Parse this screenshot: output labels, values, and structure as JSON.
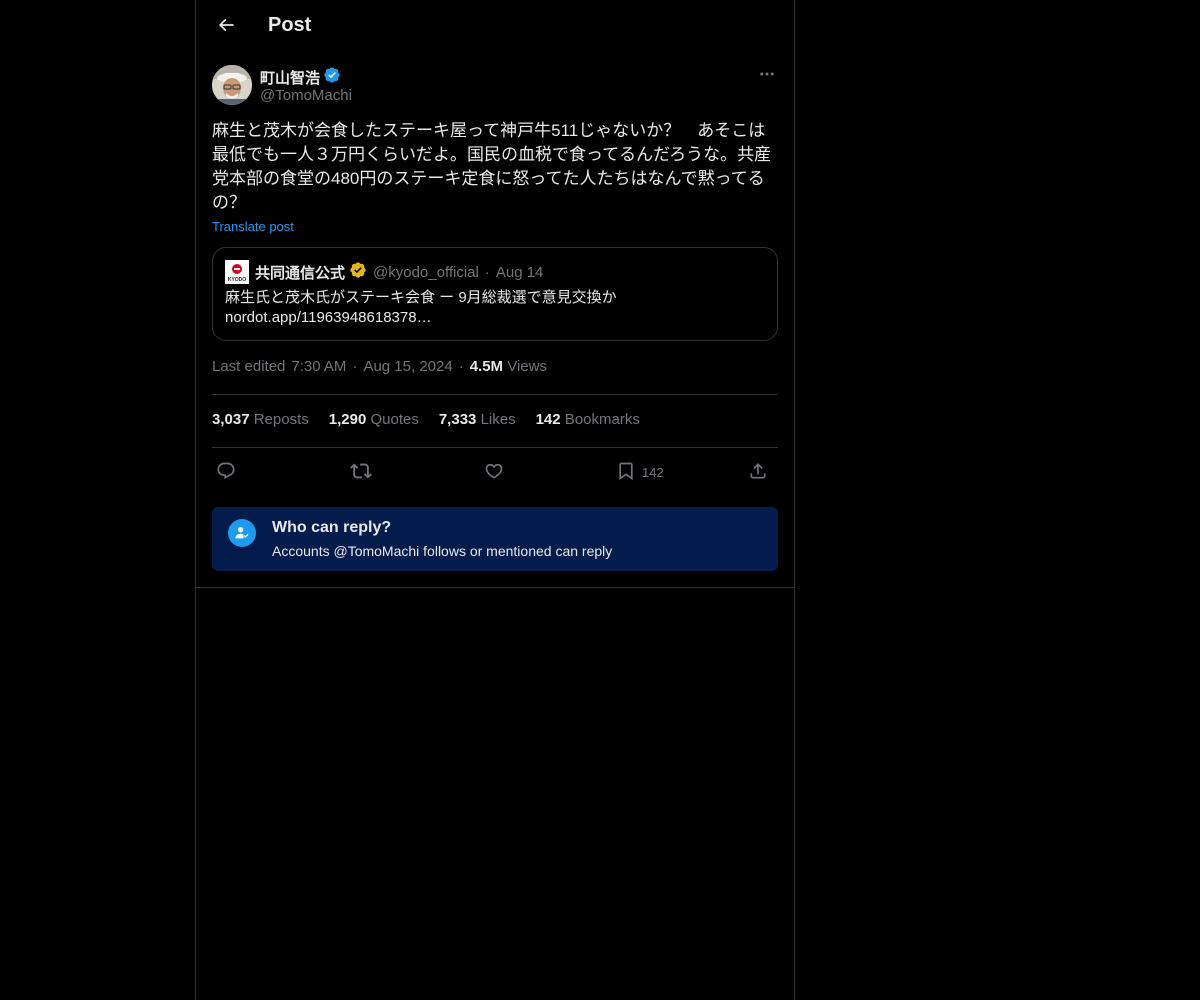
{
  "header": {
    "title": "Post"
  },
  "author": {
    "name": "町山智浩",
    "handle": "@TomoMachi"
  },
  "post": {
    "text": "麻生と茂木が会食したステーキ屋って神戸牛511じゃないか？　あそこは最低でも一人３万円くらいだよ。国民の血税で食ってるんだろうな。共産党本部の食堂の480円のステーキ定食に怒ってた人たちはなんで黙ってるの？",
    "translate_label": "Translate post"
  },
  "quote": {
    "name": "共同通信公式",
    "handle": "@kyodo_official",
    "separator": "·",
    "date": "Aug 14",
    "text": "麻生氏と茂木氏がステーキ会食 ー 9月総裁選で意見交換か",
    "link": "nordot.app/11963948618378…",
    "logo_text": "KYODO"
  },
  "meta": {
    "edited": "Last edited",
    "time": "7:30 AM",
    "sep1": "·",
    "date": "Aug 15, 2024",
    "sep2": "·",
    "views_count": "4.5M",
    "views_label": "Views"
  },
  "stats": {
    "reposts_count": "3,037",
    "reposts_label": "Reposts",
    "quotes_count": "1,290",
    "quotes_label": "Quotes",
    "likes_count": "7,333",
    "likes_label": "Likes",
    "bookmarks_count": "142",
    "bookmarks_label": "Bookmarks"
  },
  "actions": {
    "bookmark_count": "142"
  },
  "reply_settings": {
    "title": "Who can reply?",
    "subtitle": "Accounts @TomoMachi follows or mentioned can reply"
  },
  "colors": {
    "accent": "#1d9bf0",
    "verified_gold": "#e2b719",
    "reply_bg": "#031c4b"
  }
}
